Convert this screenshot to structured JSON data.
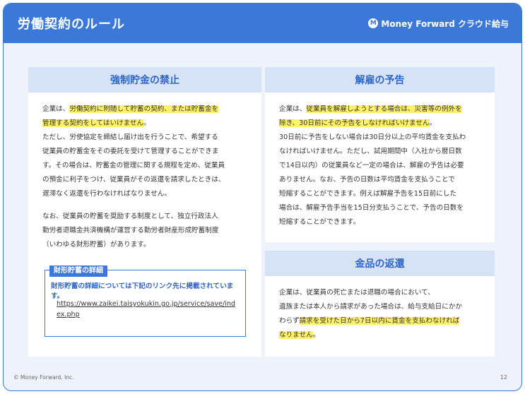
{
  "header": {
    "title": "労働契約のルール",
    "brand": "Money Forward クラウド給与"
  },
  "left": {
    "heading": "強制貯金の禁止",
    "p1_pre": "企業は、",
    "p1_mark_a": "労働契約に附随して貯蓄の契約、または貯蓄金を",
    "p1_mark_b": "管理する契約をしてはいけません",
    "p1_post": "。",
    "p1_line3": "ただし、労使協定を締結し届け出を行うことで、希望する",
    "p1_line4": "従業員の貯蓄金をその委託を受けて管理することができま",
    "p1_line5": "す。その場合は、貯蓄金の管理に関する規程を定め、従業員",
    "p1_line6": "の預金に利子をつけ、従業員がその返還を請求したときは、",
    "p1_line7": "遅滞なく返還を行わなければなりません。",
    "p2_line1": "なお、従業員の貯蓄を奨励する制度として、独立行政法人",
    "p2_line2": "勤労者退職金共済機構が運営する勤労者財産形成貯蓄制度",
    "p2_line3": "（いわゆる財形貯蓄）があります。",
    "callout_tag": "財形貯蓄の詳細",
    "callout_desc": "財形貯蓄の詳細については下記のリンク先に掲載されています。",
    "callout_link": "https://www.zaikei.taisyokukin.go.jp/service/save/index.php"
  },
  "right_top": {
    "heading": "解雇の予告",
    "l1_pre": "企業は、",
    "l1_mark_a": "従業員を解雇しようとする場合は、災害等の例外を",
    "l1_mark_b": "除き、30日前にその予告をしなければいけません",
    "l1_post": "。",
    "l3": "30日前に予告をしない場合は30日分以上の平均賃金を支払わ",
    "l4": "なければいけません。ただし、試用期間中（入社から暦日数",
    "l5": "で14日以内）の従業員など一定の場合は、解雇の予告は必要",
    "l6": "ありません。なお、予告の日数は平均賃金を支払うことで",
    "l7": "短縮することができます。例えば解雇予告を15日前にした",
    "l8": "場合は、解雇予告手当を15日分支払うことで、予告の日数を",
    "l9": "短縮することができます。"
  },
  "right_bot": {
    "heading": "金品の返還",
    "l1": "企業は、従業員の死亡または退職の場合において、",
    "l2": "遺族または本人から請求があった場合は、給与支給日にかか",
    "l3_pre": "わらず",
    "l3_mark": "請求を受けた日から7日以内に賃金を支払わなければ",
    "l4_mark": "なりません",
    "l4_post": "。"
  },
  "footer": {
    "copyright": "© Money Forward, Inc.",
    "page": "12"
  },
  "colors": {
    "accent": "#3b78d8",
    "highlight": "#fff266",
    "panel_head": "#d6e3f6"
  }
}
